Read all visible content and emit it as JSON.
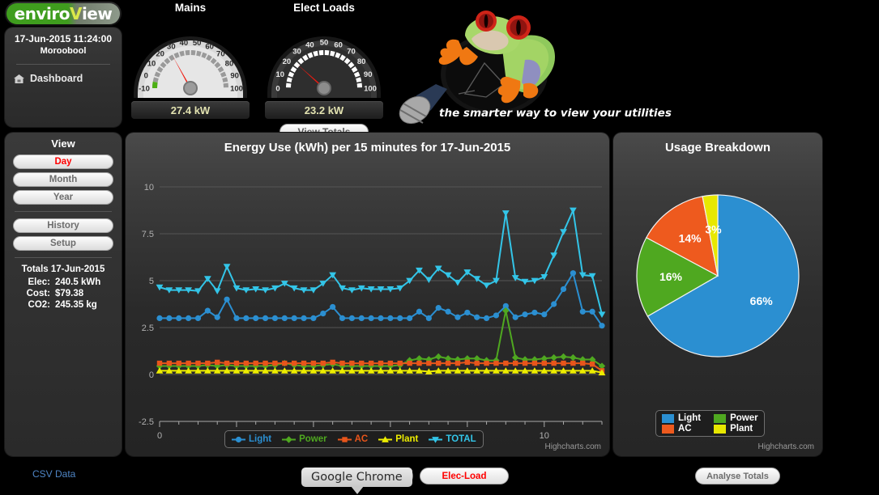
{
  "brand": {
    "logo_part1": "enviro",
    "logo_part2": "V",
    "logo_part3": "iew",
    "tagline": "the smarter way to view your utilities"
  },
  "sidebar": {
    "datetime": "17-Jun-2015 11:24:00",
    "site": "Moroobool",
    "nav_icon": "home-icon",
    "nav_label": "Dashboard",
    "view_title": "View",
    "view_buttons": [
      {
        "label": "Day",
        "active": true
      },
      {
        "label": "Month",
        "active": false
      },
      {
        "label": "Year",
        "active": false
      }
    ],
    "action_buttons": [
      {
        "label": "History"
      },
      {
        "label": "Setup"
      }
    ],
    "totals_title": "Totals 17-Jun-2015",
    "totals": [
      {
        "key": "Elec:",
        "value": "240.5 kWh"
      },
      {
        "key": "Cost:",
        "value": "$79.38"
      },
      {
        "key": "CO2:",
        "value": "245.35 kg"
      }
    ]
  },
  "gauges": [
    {
      "title": "Mains",
      "readout": "27.4 kW",
      "value": 27.4,
      "min": -10,
      "max": 100,
      "ticks": [
        -10,
        0,
        10,
        20,
        30,
        40,
        50,
        60,
        70,
        80,
        90,
        100
      ],
      "theme": "light",
      "band_color": "#4caf14"
    },
    {
      "title": "Elect Loads",
      "readout": "23.2 kW",
      "value": 23.2,
      "min": 0,
      "max": 100,
      "ticks": [
        0,
        10,
        20,
        30,
        40,
        50,
        60,
        70,
        80,
        90,
        100
      ],
      "theme": "dark",
      "band_color": "#ffffff"
    }
  ],
  "buttons": {
    "view_totals": "View Totals",
    "csv_data": "CSV Data",
    "elec_load": "Elec-Load",
    "analyse_totals": "Analyse Totals"
  },
  "tooltip": {
    "text": "Google Chrome"
  },
  "credits": {
    "highcharts": "Highcharts.com"
  },
  "chart_data": [
    {
      "type": "line",
      "title": "Energy Use (kWh) per 15 minutes for 17-Jun-2015",
      "xlabel": "",
      "ylabel": "",
      "xlim": [
        0,
        11.5
      ],
      "ylim": [
        -2.5,
        10
      ],
      "yticks": [
        -2.5,
        0,
        2.5,
        5,
        7.5,
        10
      ],
      "xticks": [
        0,
        2,
        4,
        6,
        8,
        10
      ],
      "grid": true,
      "legend_position": "bottom",
      "x": [
        0,
        0.25,
        0.5,
        0.75,
        1,
        1.25,
        1.5,
        1.75,
        2,
        2.25,
        2.5,
        2.75,
        3,
        3.25,
        3.5,
        3.75,
        4,
        4.25,
        4.5,
        4.75,
        5,
        5.25,
        5.5,
        5.75,
        6,
        6.25,
        6.5,
        6.75,
        7,
        7.25,
        7.5,
        7.75,
        8,
        8.25,
        8.5,
        8.75,
        9,
        9.25,
        9.5,
        9.75,
        10,
        10.25,
        10.5,
        10.75,
        11,
        11.25,
        11.5
      ],
      "series": [
        {
          "name": "Light",
          "color": "#2b8fd1",
          "marker": "circle",
          "values": [
            3.0,
            3.0,
            3.0,
            3.0,
            3.0,
            3.4,
            3.05,
            4.0,
            3.0,
            3.0,
            3.0,
            3.0,
            3.0,
            3.0,
            3.0,
            3.0,
            3.0,
            3.25,
            3.6,
            3.0,
            3.0,
            3.0,
            3.0,
            3.0,
            3.0,
            3.0,
            3.0,
            3.35,
            3.0,
            3.55,
            3.35,
            3.05,
            3.3,
            3.05,
            3.0,
            3.15,
            3.65,
            3.05,
            3.2,
            3.3,
            3.2,
            3.75,
            4.55,
            5.4,
            3.35,
            3.35,
            2.6
          ]
        },
        {
          "name": "Power",
          "color": "#4fa820",
          "marker": "diamond",
          "values": [
            0.45,
            0.45,
            0.45,
            0.45,
            0.45,
            0.5,
            0.45,
            0.5,
            0.45,
            0.45,
            0.45,
            0.45,
            0.5,
            0.6,
            0.5,
            0.45,
            0.45,
            0.5,
            0.55,
            0.45,
            0.45,
            0.45,
            0.45,
            0.45,
            0.45,
            0.5,
            0.75,
            0.85,
            0.8,
            0.95,
            0.85,
            0.8,
            0.85,
            0.85,
            0.75,
            0.75,
            3.4,
            0.9,
            0.8,
            0.8,
            0.85,
            0.9,
            0.95,
            0.9,
            0.8,
            0.8,
            0.45
          ]
        },
        {
          "name": "AC",
          "color": "#e8551b",
          "marker": "square",
          "values": [
            0.6,
            0.6,
            0.6,
            0.6,
            0.6,
            0.6,
            0.65,
            0.6,
            0.6,
            0.6,
            0.6,
            0.6,
            0.6,
            0.6,
            0.6,
            0.6,
            0.6,
            0.6,
            0.65,
            0.6,
            0.6,
            0.6,
            0.6,
            0.6,
            0.6,
            0.6,
            0.6,
            0.6,
            0.6,
            0.6,
            0.6,
            0.6,
            0.65,
            0.6,
            0.6,
            0.6,
            0.6,
            0.6,
            0.6,
            0.6,
            0.6,
            0.6,
            0.6,
            0.6,
            0.6,
            0.55,
            0.2
          ]
        },
        {
          "name": "Plant",
          "color": "#eded00",
          "marker": "triangle",
          "values": [
            0.2,
            0.2,
            0.2,
            0.2,
            0.2,
            0.2,
            0.2,
            0.2,
            0.2,
            0.2,
            0.2,
            0.2,
            0.2,
            0.2,
            0.2,
            0.2,
            0.2,
            0.2,
            0.2,
            0.2,
            0.2,
            0.2,
            0.2,
            0.2,
            0.2,
            0.2,
            0.2,
            0.2,
            0.15,
            0.2,
            0.2,
            0.2,
            0.2,
            0.2,
            0.2,
            0.2,
            0.2,
            0.2,
            0.2,
            0.2,
            0.2,
            0.2,
            0.2,
            0.2,
            0.2,
            0.2,
            0.1
          ]
        },
        {
          "name": "TOTAL",
          "color": "#33c5e8",
          "marker": "triangle-down",
          "values": [
            4.65,
            4.5,
            4.5,
            4.5,
            4.45,
            5.1,
            4.45,
            5.75,
            4.6,
            4.5,
            4.55,
            4.5,
            4.6,
            4.85,
            4.6,
            4.5,
            4.5,
            4.85,
            5.3,
            4.6,
            4.5,
            4.6,
            4.55,
            4.55,
            4.55,
            4.6,
            5.0,
            5.55,
            5.05,
            5.65,
            5.3,
            4.9,
            5.45,
            5.1,
            4.75,
            5.0,
            8.6,
            5.15,
            4.95,
            5.0,
            5.2,
            6.35,
            7.6,
            8.75,
            5.3,
            5.25,
            3.2
          ]
        }
      ]
    },
    {
      "type": "pie",
      "title": "Usage Breakdown",
      "legend_position": "bottom",
      "labels": [
        "Light",
        "Power",
        "AC",
        "Plant"
      ],
      "values": [
        66,
        16,
        14,
        3
      ],
      "display_labels": [
        "66%",
        "16%",
        "14%",
        "3%"
      ],
      "colors": [
        "#2b8fd1",
        "#4fa820",
        "#ee5a1e",
        "#e8e800"
      ]
    }
  ]
}
